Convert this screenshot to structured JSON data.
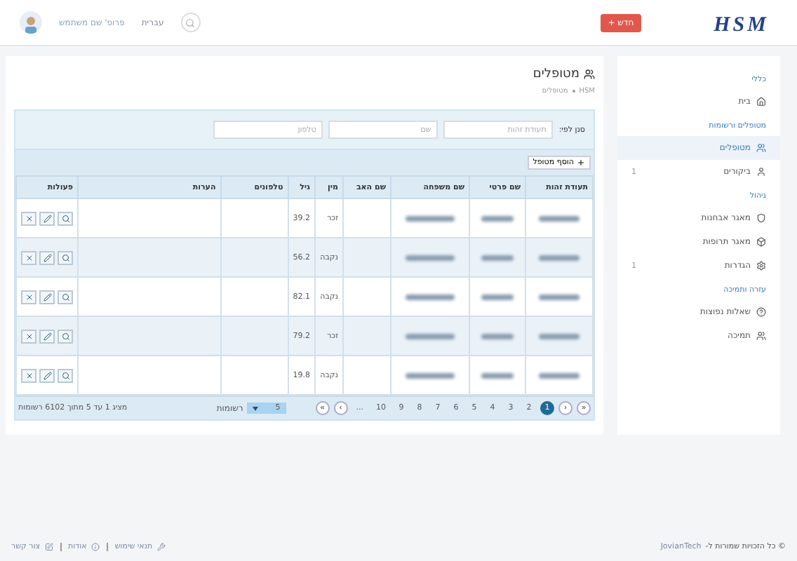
{
  "header": {
    "logo": "HSM",
    "new_button": "חדש +",
    "language": "עברית",
    "user_name": "פרופ' שם משתמש"
  },
  "sidebar": {
    "sections": [
      {
        "title": "כללי",
        "items": [
          {
            "label": "בית",
            "selected": false
          }
        ]
      },
      {
        "title": "מטופלים ורשומות",
        "items": [
          {
            "label": "מטופלים",
            "selected": true
          },
          {
            "label": "ביקורים",
            "selected": false,
            "badge": "1"
          }
        ]
      },
      {
        "title": "ניהול",
        "items": [
          {
            "label": "מאגר אבחנות",
            "selected": false
          },
          {
            "label": "מאגר תרופות",
            "selected": false
          },
          {
            "label": "הגדרות",
            "selected": false,
            "badge": "1"
          }
        ]
      },
      {
        "title": "עזרה ותמיכה",
        "items": [
          {
            "label": "שאלות נפוצות",
            "selected": false
          },
          {
            "label": "תמיכה",
            "selected": false
          }
        ]
      }
    ]
  },
  "page": {
    "title": "מטופלים",
    "breadcrumb": [
      "HSM",
      "מטופלים"
    ]
  },
  "filter": {
    "label": "סנן לפי:",
    "fields": [
      {
        "placeholder": "תעודת זהות"
      },
      {
        "placeholder": "שם"
      },
      {
        "placeholder": "טלפון"
      }
    ]
  },
  "add_button": "הוסף מטופל",
  "table": {
    "columns": [
      "תעודת זהות",
      "שם פרטי",
      "שם משפחה",
      "שם האב",
      "מין",
      "גיל",
      "טלפונים",
      "הערות",
      "פעולות"
    ],
    "rows": [
      {
        "gender": "זכר",
        "age": "39.2"
      },
      {
        "gender": "נקבה",
        "age": "56.2"
      },
      {
        "gender": "נקבה",
        "age": "82.1"
      },
      {
        "gender": "זכר",
        "age": "79.2"
      },
      {
        "gender": "נקבה",
        "age": "19.8"
      }
    ]
  },
  "pagination": {
    "first": "«",
    "prev": "‹",
    "pages": [
      {
        "label": "1",
        "selected": true
      },
      {
        "label": "2",
        "selected": false
      },
      {
        "label": "3",
        "selected": false
      },
      {
        "label": "4",
        "selected": false
      },
      {
        "label": "5",
        "selected": false
      },
      {
        "label": "6",
        "selected": false
      },
      {
        "label": "7",
        "selected": false
      },
      {
        "label": "8",
        "selected": false
      },
      {
        "label": "9",
        "selected": false
      },
      {
        "label": "10",
        "selected": false
      },
      {
        "label": "...",
        "selected": false
      }
    ],
    "next": "›",
    "last": "»",
    "page_size": "5",
    "page_size_label": "רשומות",
    "summary": "מציג 1 עד 5 מתוך 6102 רשומות"
  },
  "footer": {
    "copyright": "© כל הזכויות שמורות ל-",
    "company": "JovianTech",
    "links": [
      {
        "label": "תנאי שימוש"
      },
      {
        "label": "אודות"
      },
      {
        "label": "צור קשר"
      }
    ]
  }
}
